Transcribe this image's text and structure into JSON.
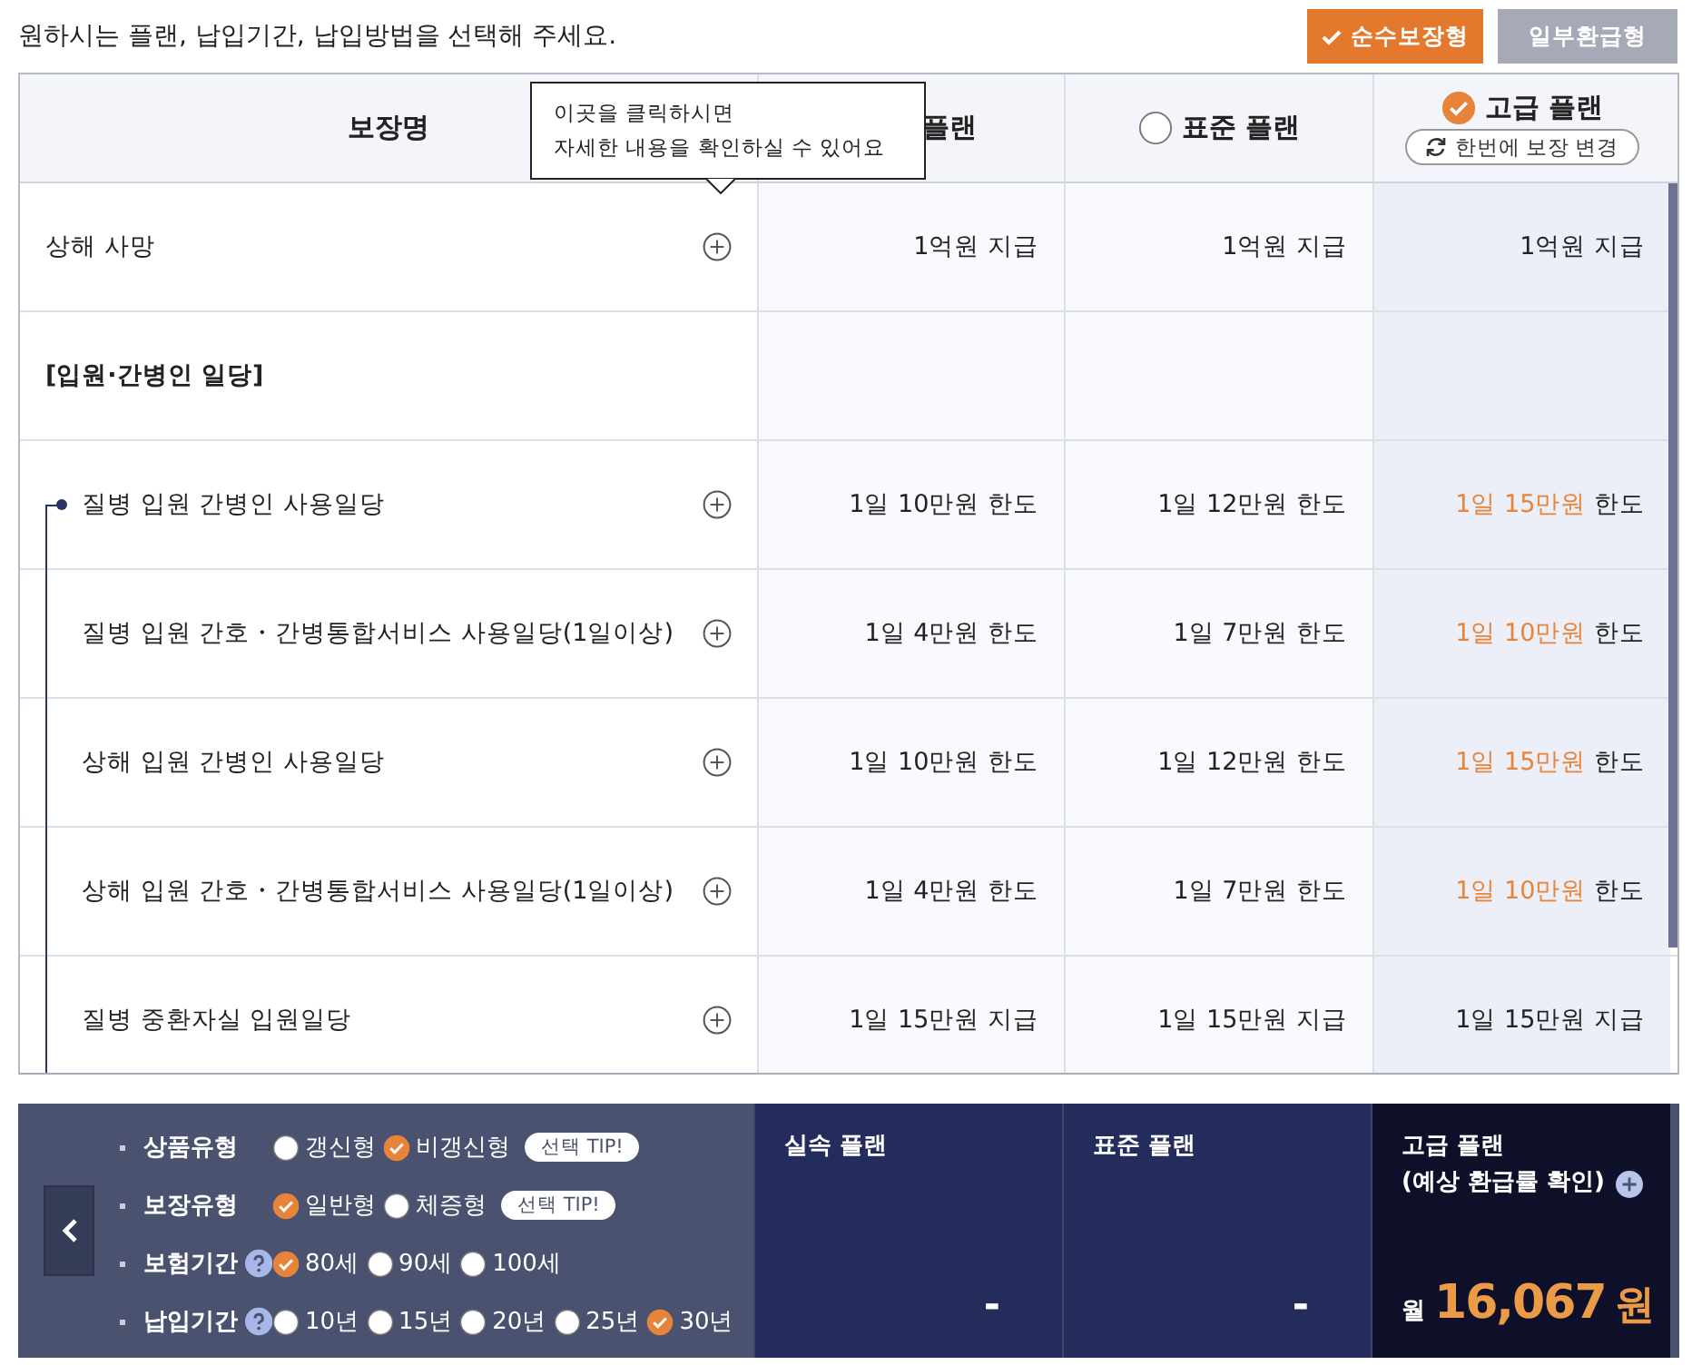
{
  "instruction": "원하시는 플랜, 납입기간, 납입방법을 선택해 주세요.",
  "refund_types": [
    {
      "label": "순수보장형",
      "selected": true
    },
    {
      "label": "일부환급형",
      "selected": false
    }
  ],
  "table": {
    "name_header": "보장명",
    "plans": [
      {
        "label": "플랜"
      },
      {
        "label": "표준 플랜",
        "selected": false
      },
      {
        "label": "고급 플랜",
        "selected": true,
        "action": "한번에 보장 변경"
      }
    ],
    "tooltip": {
      "lines": [
        "이곳을 클릭하시면",
        "자세한 내용을 확인하실 수 있어요"
      ]
    },
    "rows": [
      {
        "kind": "item",
        "name": "상해 사망",
        "cells": [
          {
            "text": "1억원 지급"
          },
          {
            "text": "1억원 지급"
          },
          {
            "text": "1억원 지급"
          }
        ]
      },
      {
        "kind": "group",
        "name": "[입원·간병인 일당]",
        "children": [
          {
            "kind": "item",
            "name": "질병 입원 간병인 사용일당",
            "cells": [
              {
                "text": "1일 10만원 한도"
              },
              {
                "text": "1일 12만원 한도"
              },
              {
                "accent": "1일 15만원",
                "text": "한도"
              }
            ]
          },
          {
            "kind": "item",
            "name": "질병 입원 간호・간병통합서비스 사용일당(1일이상)",
            "cells": [
              {
                "text": "1일 4만원 한도"
              },
              {
                "text": "1일 7만원 한도"
              },
              {
                "accent": "1일 10만원",
                "text": "한도"
              }
            ]
          },
          {
            "kind": "item",
            "name": "상해 입원 간병인 사용일당",
            "cells": [
              {
                "text": "1일 10만원 한도"
              },
              {
                "text": "1일 12만원 한도"
              },
              {
                "accent": "1일 15만원",
                "text": "한도"
              }
            ]
          },
          {
            "kind": "item",
            "name": "상해 입원 간호・간병통합서비스 사용일당(1일이상)",
            "cells": [
              {
                "text": "1일 4만원 한도"
              },
              {
                "text": "1일 7만원 한도"
              },
              {
                "accent": "1일 10만원",
                "text": "한도"
              }
            ]
          },
          {
            "kind": "item",
            "name": "질병 중환자실 입원일당",
            "cells": [
              {
                "text": "1일 15만원 지급"
              },
              {
                "text": "1일 15만원 지급"
              },
              {
                "text": "1일 15만원 지급"
              }
            ]
          }
        ]
      }
    ]
  },
  "options": [
    {
      "label": "상품유형",
      "help": false,
      "choices": [
        {
          "label": "갱신형",
          "selected": false
        },
        {
          "label": "비갱신형",
          "selected": true
        }
      ],
      "tip": "선택 TIP!"
    },
    {
      "label": "보장유형",
      "help": false,
      "choices": [
        {
          "label": "일반형",
          "selected": true
        },
        {
          "label": "체증형",
          "selected": false
        }
      ],
      "tip": "선택 TIP!"
    },
    {
      "label": "보험기간",
      "help": true,
      "choices": [
        {
          "label": "80세",
          "selected": true
        },
        {
          "label": "90세",
          "selected": false
        },
        {
          "label": "100세",
          "selected": false
        }
      ]
    },
    {
      "label": "납입기간",
      "help": true,
      "choices": [
        {
          "label": "10년",
          "selected": false
        },
        {
          "label": "15년",
          "selected": false
        },
        {
          "label": "20년",
          "selected": false
        },
        {
          "label": "25년",
          "selected": false
        },
        {
          "label": "30년",
          "selected": true
        }
      ]
    }
  ],
  "summary": [
    {
      "label": "실속 플랜",
      "selected": false,
      "value": "-"
    },
    {
      "label": "표준 플랜",
      "selected": false,
      "value": "-"
    },
    {
      "label": "고급 플랜",
      "selected": true,
      "sublabel": "(예상 환급률 확인)",
      "prefix": "월",
      "amount": "16,067",
      "unit": "원"
    }
  ]
}
